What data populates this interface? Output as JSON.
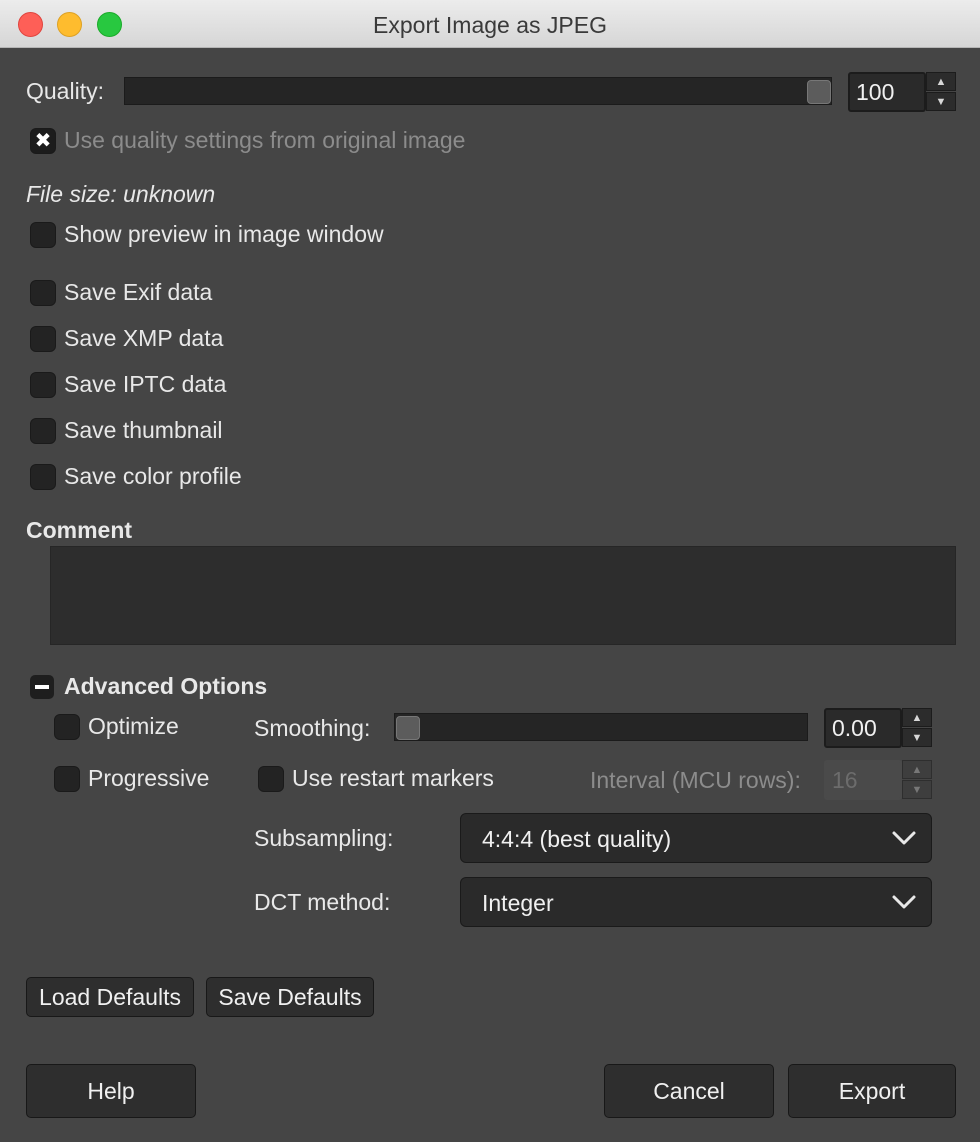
{
  "window": {
    "title": "Export Image as JPEG"
  },
  "quality": {
    "label": "Quality:",
    "value": "100",
    "slider_fraction": 1.0,
    "use_original_label": "Use quality settings from original image",
    "use_original_checked": true
  },
  "file_size": {
    "label": "File size: unknown"
  },
  "preview": {
    "label": "Show preview in image window",
    "checked": false
  },
  "metadata": {
    "exif": "Save Exif data",
    "xmp": "Save XMP data",
    "iptc": "Save IPTC data",
    "thumbnail": "Save thumbnail",
    "color_profile": "Save color profile"
  },
  "comment": {
    "label": "Comment",
    "value": ""
  },
  "advanced": {
    "label": "Advanced Options",
    "expanded": true,
    "optimize": "Optimize",
    "progressive": "Progressive",
    "smoothing_label": "Smoothing:",
    "smoothing_value": "0.00",
    "smoothing_fraction": 0.0,
    "restart_markers": "Use restart markers",
    "interval_label": "Interval (MCU rows):",
    "interval_value": "16",
    "subsampling_label": "Subsampling:",
    "subsampling_value": "4:4:4 (best quality)",
    "dct_label": "DCT method:",
    "dct_value": "Integer"
  },
  "buttons": {
    "load_defaults": "Load Defaults",
    "save_defaults": "Save Defaults",
    "help": "Help",
    "cancel": "Cancel",
    "export": "Export"
  },
  "icons": {
    "close": "close-icon",
    "minimize": "minimize-icon",
    "zoom": "zoom-icon",
    "spin_up": "arrow-up-icon",
    "spin_down": "arrow-down-icon",
    "dropdown": "chevron-down-icon",
    "checkmark": "x-check-icon",
    "collapse": "minus-icon"
  },
  "colors": {
    "close": "#fe5f57",
    "minimize": "#febc2e",
    "zoom": "#28c840",
    "background": "#454545"
  }
}
